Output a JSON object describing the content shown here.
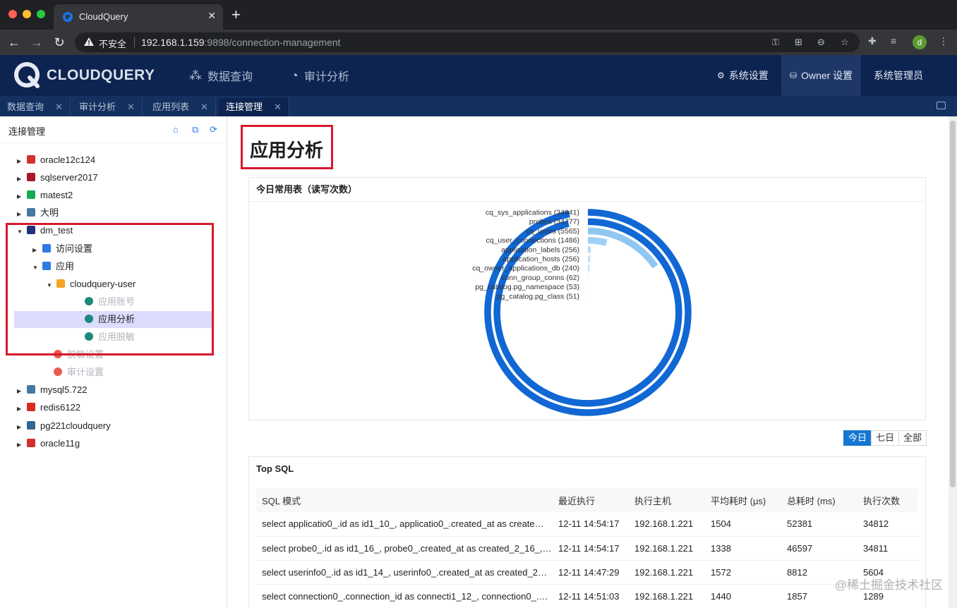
{
  "browser": {
    "tab_title": "CloudQuery",
    "insecure_label": "不安全",
    "url_host": "192.168.1.159",
    "url_rest": ":9898/connection-management",
    "profile_initial": "d"
  },
  "header": {
    "logo_text": "CLOUDQUERY",
    "nav": [
      "数据查询",
      "审计分析"
    ],
    "right": [
      "系统设置",
      "Owner 设置",
      "系统管理员"
    ]
  },
  "app_tabs": [
    "数据查询",
    "审计分析",
    "应用列表",
    "连接管理"
  ],
  "sidebar": {
    "title": "连接管理",
    "tree": [
      {
        "label": "oracle12c124",
        "icon_color": "#d32f2f",
        "icon": "oracle-icon"
      },
      {
        "label": "sqlserver2017",
        "icon_color": "#a8182d",
        "icon": "sqlserver-icon"
      },
      {
        "label": "matest2",
        "icon_color": "#13aa52",
        "icon": "mongodb-icon"
      },
      {
        "label": "大明",
        "icon_color": "#4479a1",
        "icon": "mysql-icon"
      },
      {
        "label": "dm_test",
        "icon_color": "#23307a",
        "icon": "dameng-icon"
      },
      {
        "label": "访问设置",
        "icon_color": "#2d7be5",
        "icon": "list-icon"
      },
      {
        "label": "应用",
        "icon_color": "#2d7be5",
        "icon": "list-icon"
      },
      {
        "label": "cloudquery-user",
        "icon_color": "#f5a623",
        "icon": "cube-icon"
      },
      {
        "label": "应用账号",
        "icon_color": "#1b8a7a",
        "icon": "app-icon"
      },
      {
        "label": "应用分析",
        "icon_color": "#1b8a7a",
        "icon": "app-icon"
      },
      {
        "label": "应用脱敏",
        "icon_color": "#1b8a7a",
        "icon": "app-icon"
      },
      {
        "label": "脱敏设置",
        "icon_color": "#e85a4f",
        "icon": "gear-icon"
      },
      {
        "label": "审计设置",
        "icon_color": "#e85a4f",
        "icon": "gear-icon"
      },
      {
        "label": "mysql5.722",
        "icon_color": "#4479a1",
        "icon": "mysql-icon"
      },
      {
        "label": "redis6122",
        "icon_color": "#d82c20",
        "icon": "redis-icon"
      },
      {
        "label": "pg221cloudquery",
        "icon_color": "#336791",
        "icon": "postgres-icon"
      },
      {
        "label": "oracle11g",
        "icon_color": "#d32f2f",
        "icon": "oracle-icon"
      }
    ]
  },
  "main": {
    "page_title": "应用分析",
    "chart_card_title": "今日常用表（读写次数）",
    "range_buttons": [
      "今日",
      "七日",
      "全部"
    ],
    "top_sql_title": "Top SQL",
    "table": {
      "headers": [
        "SQL 模式",
        "最近执行",
        "执行主机",
        "平均耗时 (μs)",
        "总耗时 (ms)",
        "执行次数"
      ],
      "rows": [
        [
          "select applicatio0_.id as id1_10_, applicatio0_.created_at as create…",
          "12-11 14:54:17",
          "192.168.1.221",
          "1504",
          "52381",
          "34812"
        ],
        [
          "select probe0_.id as id1_16_, probe0_.created_at as created_2_16_,…",
          "12-11 14:54:17",
          "192.168.1.221",
          "1338",
          "46597",
          "34811"
        ],
        [
          "select userinfo0_.id as id1_14_, userinfo0_.created_at as created_2…",
          "12-11 14:47:29",
          "192.168.1.221",
          "1572",
          "8812",
          "5604"
        ],
        [
          "select connection0_.connection_id as connecti1_12_, connection0_.…",
          "12-11 14:51:03",
          "192.168.1.221",
          "1440",
          "1857",
          "1289"
        ]
      ]
    }
  },
  "chart_data": {
    "type": "bar",
    "subtype": "radial-bar",
    "categories": [
      "cq_sys_applications",
      "probes",
      "cq_users",
      "cq_user_connections",
      "application_labels",
      "application_hosts",
      "cq_owner_applications_db",
      "conn_group_conns",
      "pg_catalog.pg_namespace",
      "pg_catalog.pg_class"
    ],
    "values": [
      34941,
      34777,
      5565,
      1486,
      256,
      256,
      240,
      62,
      53,
      51
    ],
    "colors": [
      "#1167d4",
      "#1167d4",
      "#8fc7f2",
      "#9fd0f5",
      "#b5dcf8",
      "#bfe1f9",
      "#c8e6fa",
      "#d6edfb",
      "#dff1fc",
      "#e6f4fd"
    ]
  },
  "watermark": "@稀土掘金技术社区"
}
